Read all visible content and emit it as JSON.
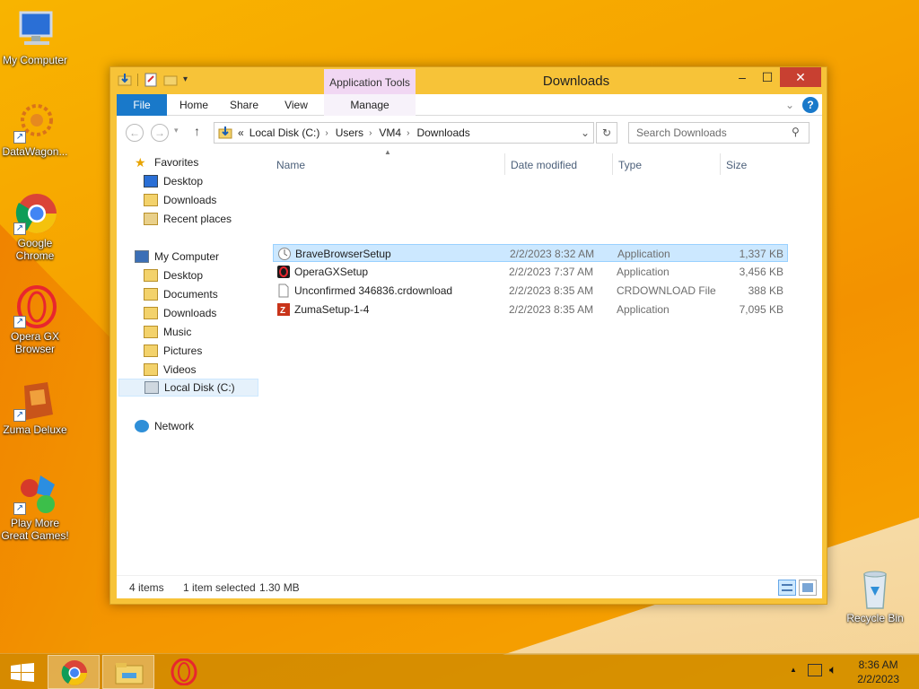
{
  "desktop": {
    "icons": [
      {
        "label": "My Computer"
      },
      {
        "label": "DataWagon..."
      },
      {
        "label": "Google Chrome"
      },
      {
        "label": "Opera GX Browser"
      },
      {
        "label": "Zuma Deluxe"
      },
      {
        "label": "Play More Great Games!"
      },
      {
        "label": "Recycle Bin"
      }
    ]
  },
  "window": {
    "title": "Downloads",
    "contextual_tab": "Application Tools",
    "controls": {
      "minimize": "–",
      "maximize": "☐",
      "close": "✕"
    },
    "ribbon_tabs": [
      "File",
      "Home",
      "Share",
      "View",
      "Manage"
    ],
    "address": {
      "prefix": "«",
      "crumbs": [
        "Local Disk (C:)",
        "Users",
        "VM4",
        "Downloads"
      ]
    },
    "search_placeholder": "Search Downloads",
    "nav_pane": {
      "favorites_label": "Favorites",
      "favorites": [
        "Desktop",
        "Downloads",
        "Recent places"
      ],
      "computer_label": "My Computer",
      "computer": [
        "Desktop",
        "Documents",
        "Downloads",
        "Music",
        "Pictures",
        "Videos",
        "Local Disk (C:)"
      ],
      "network_label": "Network"
    },
    "columns": [
      "Name",
      "Date modified",
      "Type",
      "Size"
    ],
    "files": [
      {
        "name": "BraveBrowserSetup",
        "date": "2/2/2023 8:32 AM",
        "type": "Application",
        "size": "1,337 KB",
        "selected": true
      },
      {
        "name": "OperaGXSetup",
        "date": "2/2/2023 7:37 AM",
        "type": "Application",
        "size": "3,456 KB"
      },
      {
        "name": "Unconfirmed 346836.crdownload",
        "date": "2/2/2023 8:35 AM",
        "type": "CRDOWNLOAD File",
        "size": "388 KB"
      },
      {
        "name": "ZumaSetup-1-4",
        "date": "2/2/2023 8:35 AM",
        "type": "Application",
        "size": "7,095 KB"
      }
    ],
    "status": {
      "count": "4 items",
      "selection": "1 item selected",
      "size": "1.30 MB"
    }
  },
  "taskbar": {
    "time": "8:36 AM",
    "date": "2/2/2023",
    "tray_arrow": "▲"
  },
  "colors": {
    "file_tab": "#1979ca",
    "selection": "#cce8ff",
    "window_frame": "#f7c338",
    "close": "#c84031"
  }
}
